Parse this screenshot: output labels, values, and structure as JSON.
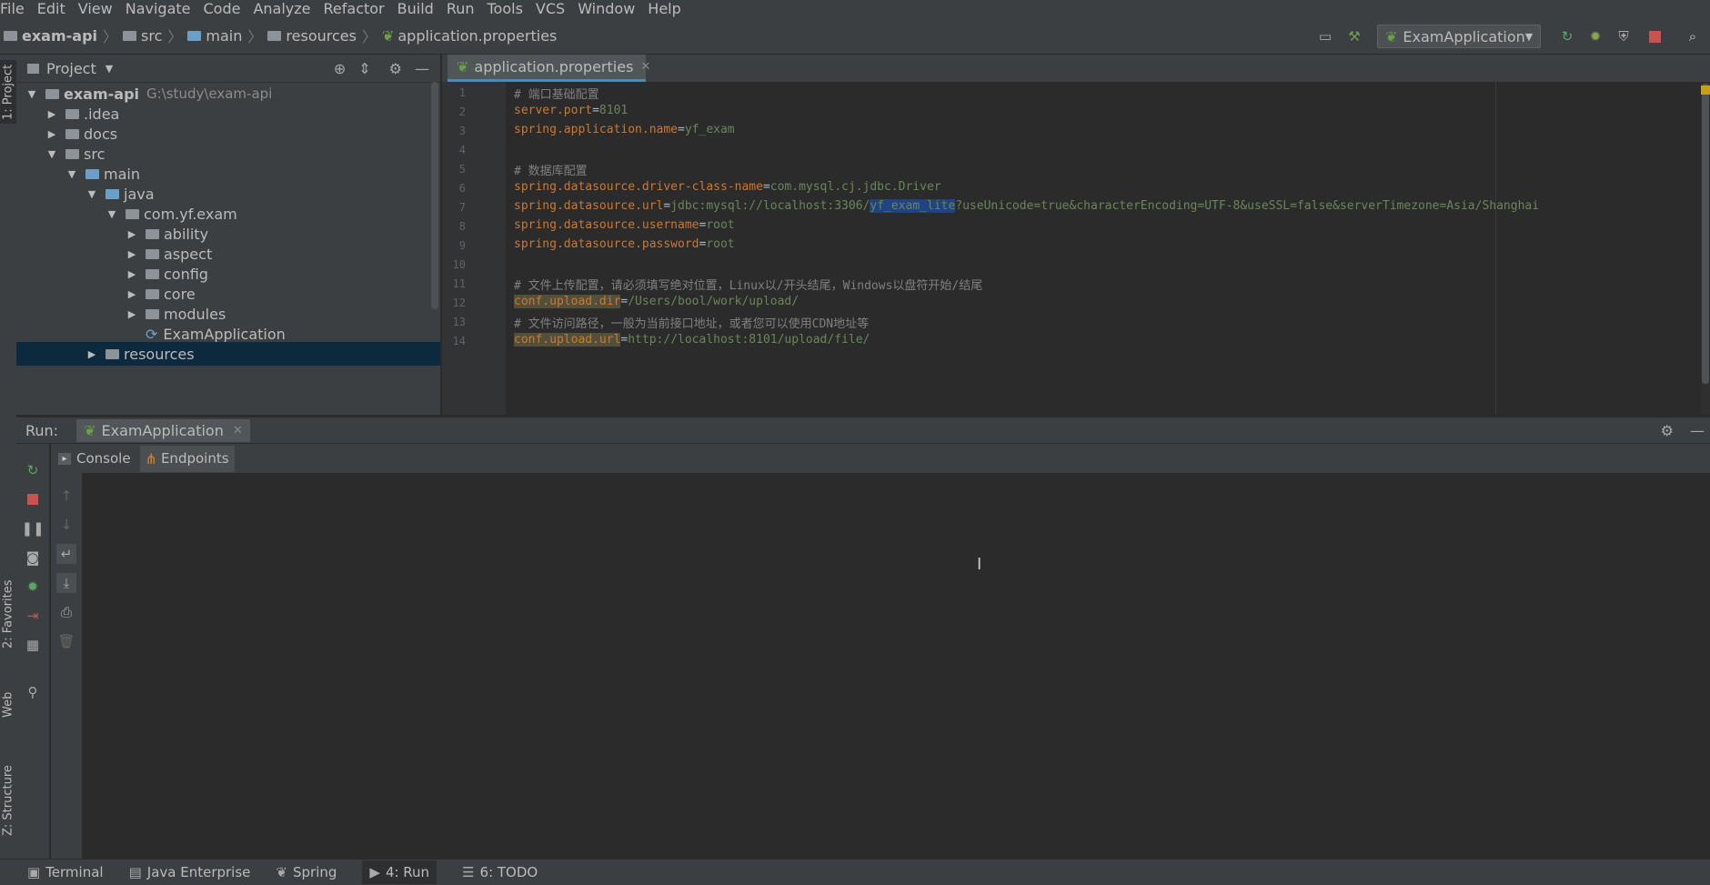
{
  "menu": [
    "File",
    "Edit",
    "View",
    "Navigate",
    "Code",
    "Analyze",
    "Refactor",
    "Build",
    "Run",
    "Tools",
    "VCS",
    "Window",
    "Help"
  ],
  "breadcrumb": {
    "project": "exam-api",
    "items": [
      "src",
      "main",
      "resources",
      "application.properties"
    ]
  },
  "run_config": "ExamApplication",
  "left_strip": {
    "project": "1: Project",
    "favorites": "2: Favorites",
    "web": "Web",
    "structure": "Z: Structure"
  },
  "project_panel": {
    "title": "Project",
    "tree": [
      {
        "label": "exam-api",
        "extra": "G:\\study\\exam-api",
        "depth": 0,
        "arrow": "▼",
        "bold": true
      },
      {
        "label": ".idea",
        "depth": 1,
        "arrow": "▶"
      },
      {
        "label": "docs",
        "depth": 1,
        "arrow": "▶"
      },
      {
        "label": "src",
        "depth": 1,
        "arrow": "▼"
      },
      {
        "label": "main",
        "depth": 2,
        "arrow": "▼"
      },
      {
        "label": "java",
        "depth": 3,
        "arrow": "▼"
      },
      {
        "label": "com.yf.exam",
        "depth": 4,
        "arrow": "▼"
      },
      {
        "label": "ability",
        "depth": 5,
        "arrow": "▶"
      },
      {
        "label": "aspect",
        "depth": 5,
        "arrow": "▶"
      },
      {
        "label": "config",
        "depth": 5,
        "arrow": "▶"
      },
      {
        "label": "core",
        "depth": 5,
        "arrow": "▶"
      },
      {
        "label": "modules",
        "depth": 5,
        "arrow": "▶"
      },
      {
        "label": "ExamApplication",
        "depth": 5,
        "arrow": ""
      },
      {
        "label": "resources",
        "depth": 3,
        "arrow": "▶"
      }
    ]
  },
  "editor": {
    "tab": "application.properties",
    "lines": [
      {
        "n": "1",
        "text": "# 端口基础配置"
      },
      {
        "n": "2",
        "key": "server.port",
        "val": "8101"
      },
      {
        "n": "3",
        "key": "spring.application.name",
        "val": "yf_exam"
      },
      {
        "n": "4",
        "text": ""
      },
      {
        "n": "5",
        "text": "# 数据库配置"
      },
      {
        "n": "6",
        "key": "spring.datasource.driver-class-name",
        "val": "com.mysql.cj.jdbc.Driver"
      },
      {
        "n": "7",
        "key": "spring.datasource.url",
        "val_pre": "jdbc:mysql://localhost:3306/",
        "val_sel": "yf_exam_lite",
        "val_post": "?useUnicode=true&characterEncoding=UTF-8&useSSL=false&serverTimezone=Asia/Shanghai"
      },
      {
        "n": "8",
        "key": "spring.datasource.username",
        "val": "root"
      },
      {
        "n": "9",
        "key": "spring.datasource.password",
        "val": "root"
      },
      {
        "n": "10",
        "text": ""
      },
      {
        "n": "11",
        "text": "# 文件上传配置，请必须填写绝对位置，Linux以/开头结尾，Windows以盘符开始/结尾"
      },
      {
        "n": "12",
        "key": "conf.upload.dir",
        "val": "/Users/bool/work/upload/",
        "warn": true
      },
      {
        "n": "13",
        "text": "# 文件访问路径，一般为当前接口地址，或者您可以使用CDN地址等"
      },
      {
        "n": "14",
        "key": "conf.upload.url",
        "val": "http://localhost:8101/upload/file/",
        "warn": true
      }
    ]
  },
  "run_panel": {
    "label": "Run:",
    "tab": "ExamApplication",
    "console": "Console",
    "endpoints": "Endpoints"
  },
  "status_bar": {
    "terminal": "Terminal",
    "java_enterprise": "Java Enterprise",
    "spring": "Spring",
    "run": "4: Run",
    "todo": "6: TODO"
  }
}
